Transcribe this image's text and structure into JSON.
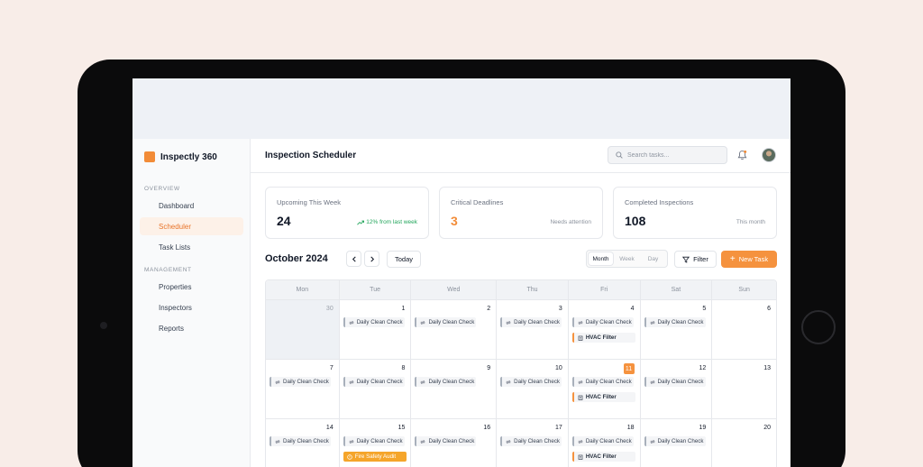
{
  "app": {
    "name": "Inspectly 360",
    "brand_color": "#f28c38"
  },
  "sidebar": {
    "sections": [
      {
        "label": "Overview",
        "items": [
          {
            "label": "Dashboard",
            "active": false
          },
          {
            "label": "Scheduler",
            "active": true
          },
          {
            "label": "Task Lists",
            "active": false
          }
        ]
      },
      {
        "label": "Management",
        "items": [
          {
            "label": "Properties",
            "active": false
          },
          {
            "label": "Inspectors",
            "active": false
          },
          {
            "label": "Reports",
            "active": false
          }
        ]
      }
    ]
  },
  "header": {
    "title": "Inspection Scheduler",
    "search_placeholder": "Search tasks..."
  },
  "stats": [
    {
      "label": "Upcoming This Week",
      "value": "24",
      "note": "12% from last week",
      "note_color": "#22a55b",
      "value_color": "#111827"
    },
    {
      "label": "Critical Deadlines",
      "value": "3",
      "note": "Needs attention",
      "note_color": "#8a919c",
      "value_color": "#f28c38"
    },
    {
      "label": "Completed Inspections",
      "value": "108",
      "note": "This month",
      "note_color": "#8a919c",
      "value_color": "#111827"
    }
  ],
  "toolbar": {
    "month_title": "October 2024",
    "today_label": "Today",
    "views": [
      {
        "label": "Month",
        "active": true
      },
      {
        "label": "Week",
        "active": false
      },
      {
        "label": "Day",
        "active": false
      }
    ],
    "filter_label": "Filter",
    "new_task_label": "New Task"
  },
  "calendar": {
    "weekdays": [
      "Mon",
      "Tue",
      "Wed",
      "Thu",
      "Fri",
      "Sat",
      "Sun"
    ],
    "weeks": [
      [
        {
          "day": "30",
          "muted": true,
          "events": []
        },
        {
          "day": "1",
          "events": [
            {
              "type": "daily",
              "label": "Daily Clean Check"
            }
          ]
        },
        {
          "day": "2",
          "events": [
            {
              "type": "daily",
              "label": "Daily Clean Check"
            }
          ]
        },
        {
          "day": "3",
          "events": [
            {
              "type": "daily",
              "label": "Daily Clean Check"
            }
          ]
        },
        {
          "day": "4",
          "events": [
            {
              "type": "daily",
              "label": "Daily Clean Check"
            },
            {
              "type": "hvac",
              "label": "HVAC Filter"
            }
          ]
        },
        {
          "day": "5",
          "events": [
            {
              "type": "daily",
              "label": "Daily Clean Check"
            }
          ]
        },
        {
          "day": "6",
          "events": []
        }
      ],
      [
        {
          "day": "7",
          "events": [
            {
              "type": "daily",
              "label": "Daily Clean Check"
            }
          ]
        },
        {
          "day": "8",
          "events": [
            {
              "type": "daily",
              "label": "Daily Clean Check"
            }
          ]
        },
        {
          "day": "9",
          "events": [
            {
              "type": "daily",
              "label": "Daily Clean Check"
            }
          ]
        },
        {
          "day": "10",
          "events": [
            {
              "type": "daily",
              "label": "Daily Clean Check"
            }
          ]
        },
        {
          "day": "11",
          "today": true,
          "events": [
            {
              "type": "daily",
              "label": "Daily Clean Check"
            },
            {
              "type": "hvac",
              "label": "HVAC Filter"
            }
          ]
        },
        {
          "day": "12",
          "events": [
            {
              "type": "daily",
              "label": "Daily Clean Check"
            }
          ]
        },
        {
          "day": "13",
          "events": []
        }
      ],
      [
        {
          "day": "14",
          "events": [
            {
              "type": "daily",
              "label": "Daily Clean Check"
            }
          ]
        },
        {
          "day": "15",
          "events": [
            {
              "type": "daily",
              "label": "Daily Clean Check"
            },
            {
              "type": "fire",
              "label": "Fire Safety Audit"
            }
          ]
        },
        {
          "day": "16",
          "events": [
            {
              "type": "daily",
              "label": "Daily Clean Check"
            }
          ]
        },
        {
          "day": "17",
          "events": [
            {
              "type": "daily",
              "label": "Daily Clean Check"
            }
          ]
        },
        {
          "day": "18",
          "events": [
            {
              "type": "daily",
              "label": "Daily Clean Check"
            },
            {
              "type": "hvac",
              "label": "HVAC Filter"
            }
          ]
        },
        {
          "day": "19",
          "events": [
            {
              "type": "daily",
              "label": "Daily Clean Check"
            }
          ]
        },
        {
          "day": "20",
          "events": []
        }
      ]
    ]
  }
}
